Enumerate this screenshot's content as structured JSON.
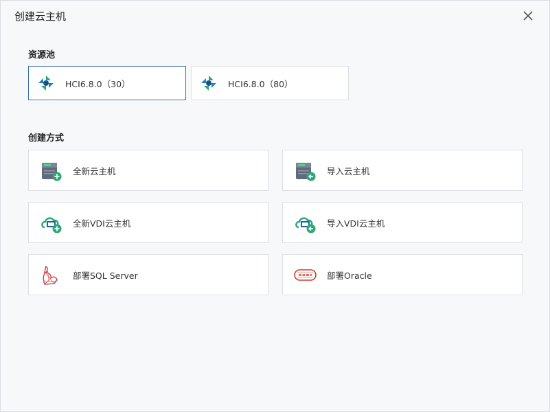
{
  "dialog": {
    "title": "创建云主机"
  },
  "resource_pool": {
    "label": "资源池",
    "items": [
      {
        "name": "HCI6.8.0（30）",
        "selected": true
      },
      {
        "name": "HCI6.8.0（80）",
        "selected": false
      }
    ]
  },
  "create_method": {
    "label": "创建方式",
    "items": [
      {
        "label": "全新云主机",
        "icon": "server-add-icon"
      },
      {
        "label": "导入云主机",
        "icon": "server-import-icon"
      },
      {
        "label": "全新VDI云主机",
        "icon": "vdi-add-icon"
      },
      {
        "label": "导入VDI云主机",
        "icon": "vdi-import-icon"
      },
      {
        "label": "部署SQL Server",
        "icon": "sql-server-icon"
      },
      {
        "label": "部署Oracle",
        "icon": "oracle-icon"
      }
    ]
  },
  "colors": {
    "selected_border": "#3a6fb5",
    "card_border": "#dcdfe4",
    "accent_green": "#2aa876"
  }
}
